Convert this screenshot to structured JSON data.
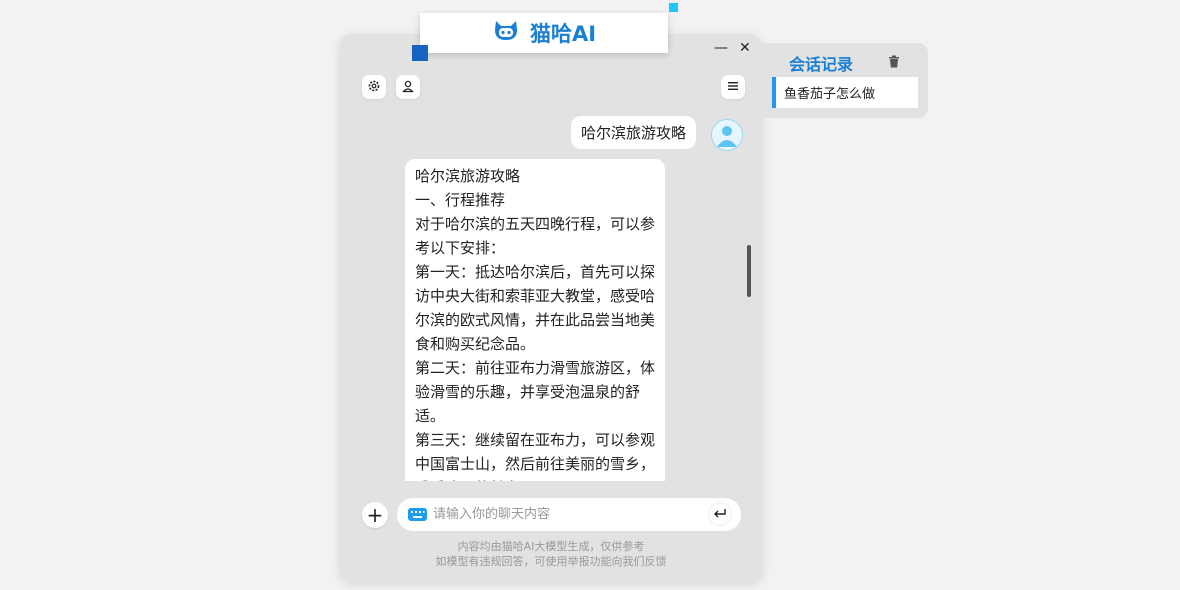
{
  "app": {
    "title": "猫哈AI"
  },
  "window_controls": {
    "minimize": "—",
    "close": "✕"
  },
  "toolbar": {
    "settings_icon": "gear-icon",
    "profile_icon": "user-icon",
    "menu_icon": "menu-icon"
  },
  "chat": {
    "messages": [
      {
        "role": "user",
        "text": "哈尔滨旅游攻略"
      },
      {
        "role": "assistant",
        "text": "哈尔滨旅游攻略\n一、行程推荐\n对于哈尔滨的五天四晚行程，可以参考以下安排：\n第一天：抵达哈尔滨后，首先可以探访中央大街和索菲亚大教堂，感受哈尔滨的欧式风情，并在此品尝当地美食和购买纪念品。\n第二天：前往亚布力滑雪旅游区，体验滑雪的乐趣，并享受泡温泉的舒适。\n第三天：继续留在亚布力，可以参观中国富士山，然后前往美丽的雪乡，感受冰雪的魅力。"
      }
    ]
  },
  "input": {
    "placeholder": "请输入你的聊天内容",
    "value": "",
    "add_label": "+"
  },
  "disclaimer": {
    "line1": "内容均由猫哈AI大模型生成，仅供参考",
    "line2": "如模型有违规回答，可使用举报功能向我们反馈"
  },
  "history": {
    "title": "会话记录",
    "items": [
      "鱼香茄子怎么做"
    ]
  },
  "colors": {
    "accent": "#1a7fd4",
    "panel_bg": "#e2e2e2"
  }
}
